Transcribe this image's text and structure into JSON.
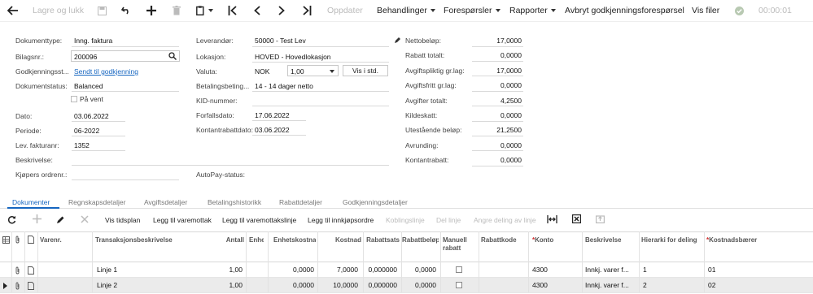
{
  "toolbar": {
    "save_close": "Lagre og lukk",
    "update": "Oppdater",
    "actions": "Behandlinger",
    "inquiries": "Forespørsler",
    "reports": "Rapporter",
    "cancel_approval": "Avbryt godkjenningsforespørsel",
    "show_files": "Vis filer",
    "timer": "00:00:01"
  },
  "form": {
    "doc_type_label": "Dokumenttype:",
    "doc_type": "Inng. faktura",
    "voucher_label": "Bilagsnr.:",
    "voucher": "200096",
    "approval_label": "Godkjenningsst...",
    "approval": "Sendt til godkjenning",
    "status_label": "Dokumentstatus:",
    "status": "Balanced",
    "on_hold_label": "På vent",
    "date_label": "Dato:",
    "date": "03.06.2022",
    "period_label": "Periode:",
    "period": "06-2022",
    "supplier_inv_label": "Lev. fakturanr:",
    "supplier_inv": "1352",
    "description_label": "Beskrivelse:",
    "description": "",
    "buyer_order_label": "Kjøpers ordrenr.:",
    "buyer_order": "",
    "supplier_label": "Leverandør:",
    "supplier": "50000 - Test Lev",
    "location_label": "Lokasjon:",
    "location": "HOVED - Hovedlokasjon",
    "currency_label": "Valuta:",
    "currency": "NOK",
    "rate": "1,00",
    "show_std": "Vis i std.",
    "terms_label": "Betalingsbeting...",
    "terms": "14 - 14 dager netto",
    "kid_label": "KID-nummer:",
    "kid": "",
    "due_label": "Forfallsdato:",
    "due": "17.06.2022",
    "cashdisc_label": "Kontantrabattdato:",
    "cashdisc": "03.06.2022",
    "autopay_label": "AutoPay-status:",
    "autopay": ""
  },
  "totals": [
    {
      "label": "Nettobeløp:",
      "value": "17,0000"
    },
    {
      "label": "Rabatt totalt:",
      "value": "0,0000"
    },
    {
      "label": "Avgiftspliktig gr.lag:",
      "value": "17,0000"
    },
    {
      "label": "Avgiftsfritt gr.lag:",
      "value": "0,0000"
    },
    {
      "label": "Avgifter totalt:",
      "value": "4,2500"
    },
    {
      "label": "Kildeskatt:",
      "value": "0,0000"
    },
    {
      "label": "Utestående beløp:",
      "value": "21,2500"
    },
    {
      "label": "Avrunding:",
      "value": "0,0000"
    },
    {
      "label": "Kontantrabatt:",
      "value": "0,0000"
    }
  ],
  "tabs": [
    "Dokumenter",
    "Regnskapsdetaljer",
    "Avgiftsdetaljer",
    "Betalingshistorikk",
    "Rabattdetaljer",
    "Godkjenningsdetaljer"
  ],
  "grid_toolbar": {
    "schedule": "Vis tidsplan",
    "add_receipt": "Legg til varemottak",
    "add_receipt_line": "Legg til varemottakslinje",
    "add_po": "Legg til innkjøpsordre",
    "link_line": "Koblingslinje",
    "del_line": "Del linje",
    "undo_alloc": "Angre deling av linje"
  },
  "columns": {
    "item": "Varenr.",
    "desc": "Transaksjonsbeskrivelse",
    "qty": "Antall",
    "uom": "Enhet",
    "unit_cost": "Enhetskostnad",
    "cost": "Kostnad",
    "disc_pct": "Rabattsats",
    "disc_amt": "Rabattbeløp",
    "manual_disc": "Manuell rabatt",
    "disc_code": "Rabattkode",
    "account": "Konto",
    "line_desc": "Beskrivelse",
    "alloc_hier": "Hierarki for deling",
    "cost_bearer": "Kostnadsbærer"
  },
  "rows": [
    {
      "desc": "Linje 1",
      "qty": "1,00",
      "unit_cost": "0,0000",
      "cost": "7,0000",
      "disc_pct": "0,000000",
      "disc_amt": "0,0000",
      "account": "4300",
      "line_desc": "Innkj. varer f...",
      "alloc": "1",
      "bearer": "01"
    },
    {
      "desc": "Linje 2",
      "qty": "1,00",
      "unit_cost": "0,0000",
      "cost": "10,0000",
      "disc_pct": "0,000000",
      "disc_amt": "0,0000",
      "account": "4300",
      "line_desc": "Innkj. varer f...",
      "alloc": "2",
      "bearer": "02"
    }
  ]
}
